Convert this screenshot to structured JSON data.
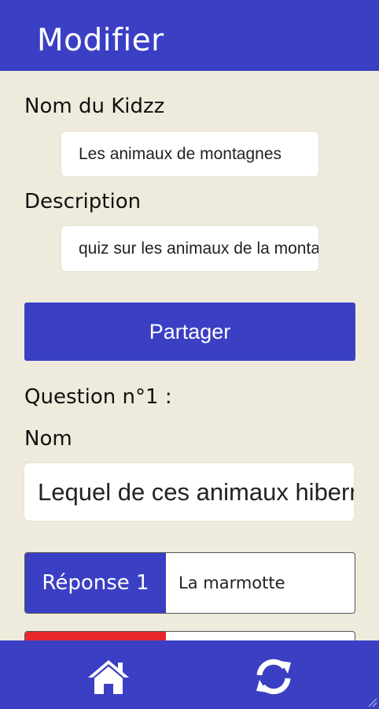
{
  "header": {
    "title": "Modifier"
  },
  "form": {
    "kidzz_name_label": "Nom du Kidzz",
    "kidzz_name_value": "Les animaux de montagnes",
    "description_label": "Description",
    "description_value": "quiz sur les animaux de la montagne",
    "share_label": "Partager"
  },
  "question": {
    "heading": "Question n°1 :",
    "name_label": "Nom",
    "name_value": "Lequel de ces animaux hiberne ?"
  },
  "answers": [
    {
      "tag": "Réponse 1",
      "value": "La marmotte",
      "color": "#3b3fc4"
    },
    {
      "tag": "",
      "value": "",
      "color": "#e8262b"
    }
  ],
  "footer": {
    "icons": [
      "home-icon",
      "refresh-icon"
    ]
  },
  "colors": {
    "primary": "#3b3fc4",
    "background": "#efebdc",
    "danger": "#e8262b"
  }
}
